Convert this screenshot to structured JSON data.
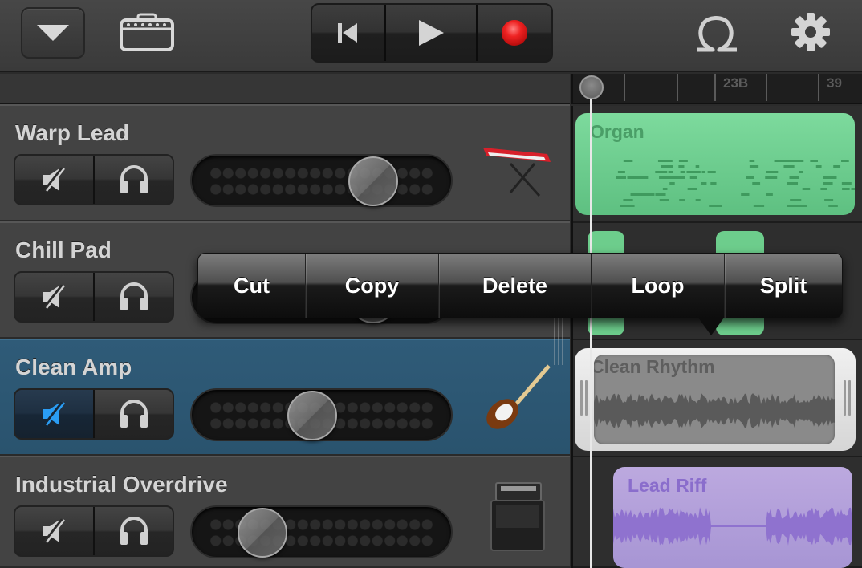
{
  "toolbar": {
    "tracks_view_button": {
      "icon": "triangle-down-icon"
    },
    "instrument_button": {
      "icon": "amp-icon"
    },
    "transport": {
      "rewind": {
        "icon": "go-to-beginning-icon"
      },
      "play": {
        "icon": "play-icon"
      },
      "record": {
        "icon": "record-icon",
        "color": "#e22222"
      }
    },
    "loop_browser_button": {
      "icon": "loop-icon"
    },
    "settings_button": {
      "icon": "gear-icon"
    }
  },
  "ruler": {
    "labels": [
      "23B",
      "39"
    ]
  },
  "tracks": [
    {
      "name": "Warp Lead",
      "muted": false,
      "soloed": false,
      "volume": 0.78,
      "instrument_icon": "keyboard-icon",
      "selected": false
    },
    {
      "name": "Chill Pad",
      "muted": false,
      "soloed": false,
      "volume": 0.78,
      "instrument_icon": "keyboard-icon",
      "selected": false
    },
    {
      "name": "Clean Amp",
      "muted": true,
      "soloed": false,
      "volume": 0.45,
      "instrument_icon": "electric-guitar-icon",
      "selected": true
    },
    {
      "name": "Industrial Overdrive",
      "muted": false,
      "soloed": false,
      "volume": 0.18,
      "instrument_icon": "guitar-amp-icon",
      "selected": false
    }
  ],
  "regions": {
    "organ": {
      "name": "Organ",
      "color": "#6fd28f"
    },
    "clean_rhythm": {
      "name": "Clean Rhythm",
      "selected": true
    },
    "lead_riff": {
      "name": "Lead Riff",
      "color": "#b19fdb"
    }
  },
  "context_menu": {
    "items": [
      "Cut",
      "Copy",
      "Delete",
      "Loop",
      "Split"
    ]
  },
  "colors": {
    "selected_track": "#2c5672",
    "mute_active": "#2a9df4"
  }
}
